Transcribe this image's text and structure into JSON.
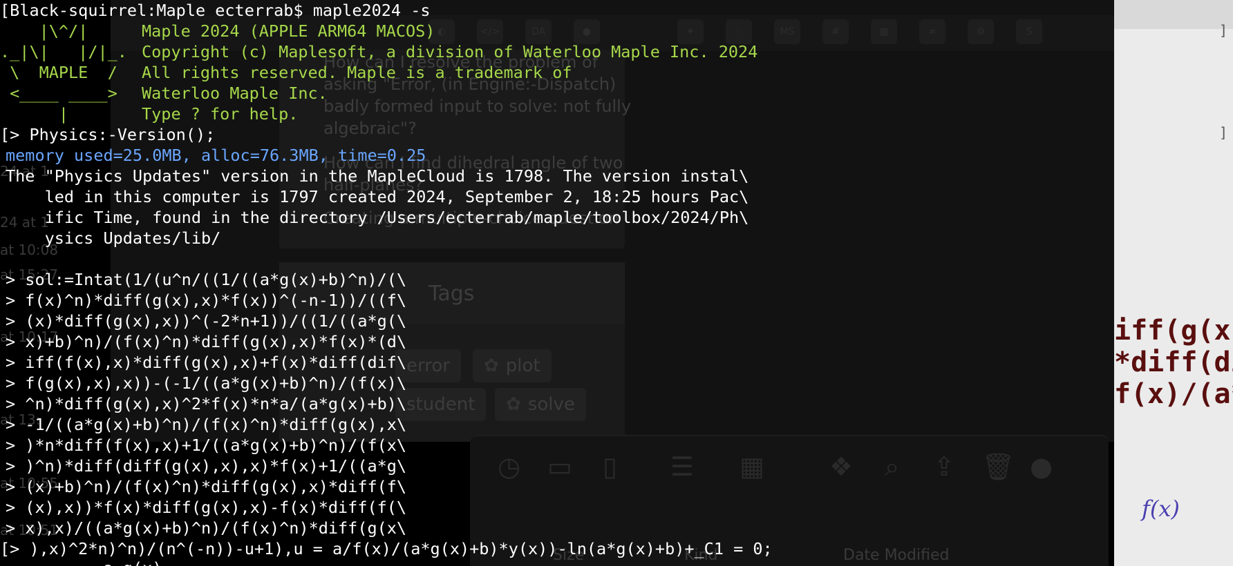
{
  "terminal": {
    "header_lines": [
      "[Black-squirrel:Maple ecterrab$ maple2024 -s"
    ],
    "banner_logo": [
      "    |\\^/|",
      "._|\\|   |/|_.",
      " \\  MAPLE  /",
      " <____ ____>",
      "      |"
    ],
    "banner_text": [
      "Maple 2024 (APPLE ARM64 MACOS)",
      "Copyright (c) Maplesoft, a division of Waterloo Maple Inc. 2024",
      "All rights reserved. Maple is a trademark of",
      "Waterloo Maple Inc.",
      "Type ? for help."
    ],
    "command_1": "[> Physics:-Version();",
    "memory_line": "memory used=25.0MB, alloc=76.3MB, time=0.25",
    "output_lines": [
      "The \"Physics Updates\" version in the MapleCloud is 1798. The version instal\\",
      "    led in this computer is 1797 created 2024, September 2, 18:25 hours Pac\\",
      "    ific Time, found in the directory /Users/ecterrab/maple/toolbox/2024/Ph\\",
      "    ysics Updates/lib/"
    ],
    "input_lines": [
      "> sol:=Intat(1/(u^n/((1/((a*g(x)+b)^n)/(\\",
      "> f(x)^n)*diff(g(x),x)*f(x))^(-n-1))/((f\\",
      "> (x)*diff(g(x),x))^(-2*n+1))/((1/((a*g(\\",
      "> x)+b)^n)/(f(x)^n)*diff(g(x),x)*f(x)*(d\\",
      "> iff(f(x),x)*diff(g(x),x)+f(x)*diff(dif\\",
      "> f(g(x),x),x))-(-1/((a*g(x)+b)^n)/(f(x)\\",
      "> ^n)*diff(g(x),x)^2*f(x)*n*a/(a*g(x)+b)\\",
      "> -1/((a*g(x)+b)^n)/(f(x)^n)*diff(g(x),x\\",
      "> )*n*diff(f(x),x)+1/((a*g(x)+b)^n)/(f(x\\",
      "> )^n)*diff(diff(g(x),x),x)*f(x)+1/((a*g\\",
      "> (x)+b)^n)/(f(x)^n)*diff(g(x),x)*diff(f\\",
      "> (x),x))*f(x)*diff(g(x),x)-f(x)*diff(f(\\",
      "> x),x)/((a*g(x)+b)^n)/(f(x)^n)*diff(g(x\\",
      "[> ),x)^2*n)^n)/(n^(-n))-u+1),u = a/f(x)/(a*g(x)+b)*y(x))-ln(a*g(x)+b)+_C1 = 0;",
      "          a g(x)"
    ]
  },
  "background": {
    "question_lines": [
      "How can I resolve the problem of",
      "asking \"Error, (in Engine:-Dispatch)",
      "badly formed input to solve: not fully",
      "algebraic\"?",
      "",
      "How can I find dihedral angle of two",
      "half-planes?",
      "",
      "Creating a multiple-choice question"
    ],
    "tags_heading": "Tags",
    "tags": [
      "error",
      "plot",
      "student",
      "solve"
    ],
    "sidebar_dates": [
      "24 at 1",
      "24 at 1",
      "at 10:08",
      "at 15:27",
      "at 10:17",
      "at 13:",
      "at 10:55",
      "at 10:51"
    ],
    "math_fragments": [
      "iff(g(x)",
      "*diff(di",
      "f(x)/(a*"
    ],
    "math_fraction": "f(x)",
    "finder_headers": [
      "Size",
      "Kind",
      "Date Modified"
    ],
    "toolbar_icons": [
      "github-icon",
      "code-icon",
      "da-icon",
      "reddit-icon",
      "twitter-icon",
      "airbnb-icon",
      "ms-icon",
      "slack-icon",
      "city-icon",
      "hash-icon",
      "settings-icon",
      "s-icon"
    ]
  }
}
